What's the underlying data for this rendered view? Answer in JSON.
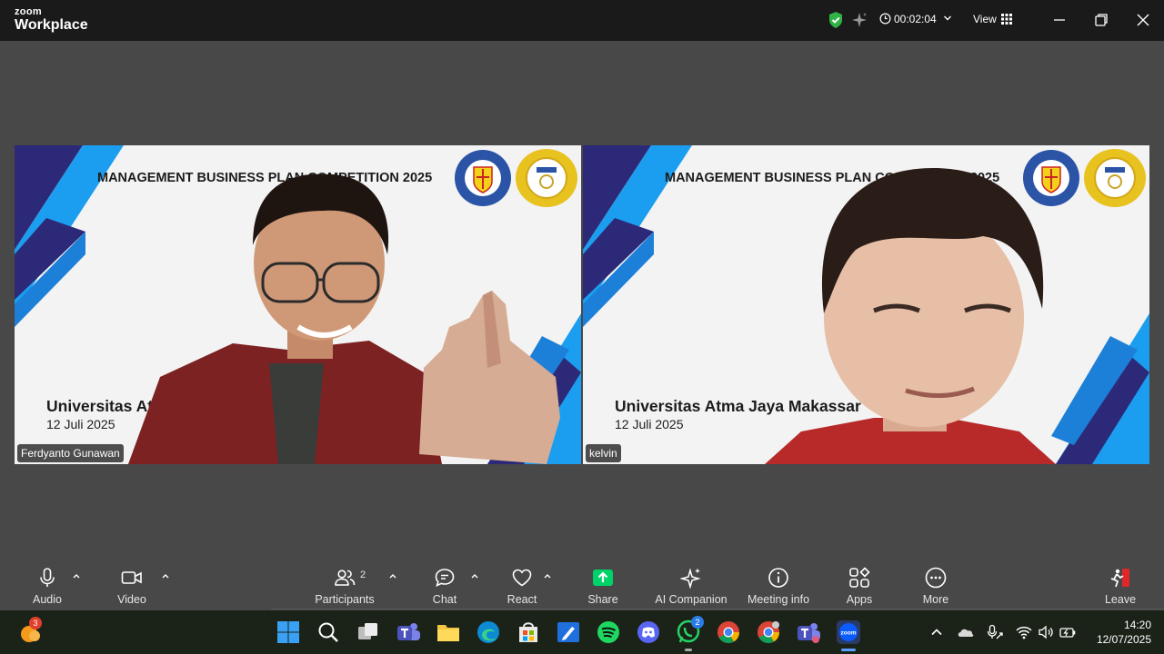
{
  "app": {
    "logo_line1": "zoom",
    "logo_line2": "Workplace"
  },
  "titlebar": {
    "timer": "00:02:04",
    "view_label": "View"
  },
  "tiles": [
    {
      "banner": "MANAGEMENT BUSINESS PLAN COMPETITION 2025",
      "university": "Universitas Atma Jaya Makassar",
      "date": "12 Juli 2025",
      "participant_name": "Ferdyanto Gunawan",
      "seal_left_text": "UNIVERSITAS ATMA JAYA",
      "seal_left_bottom": "MAKASSAR",
      "seal_right_text": "HMJM"
    },
    {
      "banner": "MANAGEMENT BUSINESS PLAN COMPETITION 2025",
      "university": "Universitas Atma Jaya Makassar",
      "date": "12 Juli 2025",
      "participant_name": "kelvin",
      "seal_left_text": "UNIVERSITAS ATMA JAYA",
      "seal_left_bottom": "MAKASSAR",
      "seal_right_text": "HMJM"
    }
  ],
  "toolbar": {
    "audio": "Audio",
    "video": "Video",
    "participants": "Participants",
    "participants_count": "2",
    "chat": "Chat",
    "react": "React",
    "share": "Share",
    "ai_companion": "AI Companion",
    "meeting_info": "Meeting info",
    "apps": "Apps",
    "more": "More",
    "leave": "Leave"
  },
  "taskbar": {
    "weather_badge": "3",
    "whatsapp_badge": "2",
    "time": "14:20",
    "date": "12/07/2025",
    "zoom_label": "zoom"
  },
  "colors": {
    "accent_blue": "#0b5cff",
    "share_green": "#00d26a",
    "leave_red": "#e02828",
    "shield_green": "#2fb344"
  }
}
